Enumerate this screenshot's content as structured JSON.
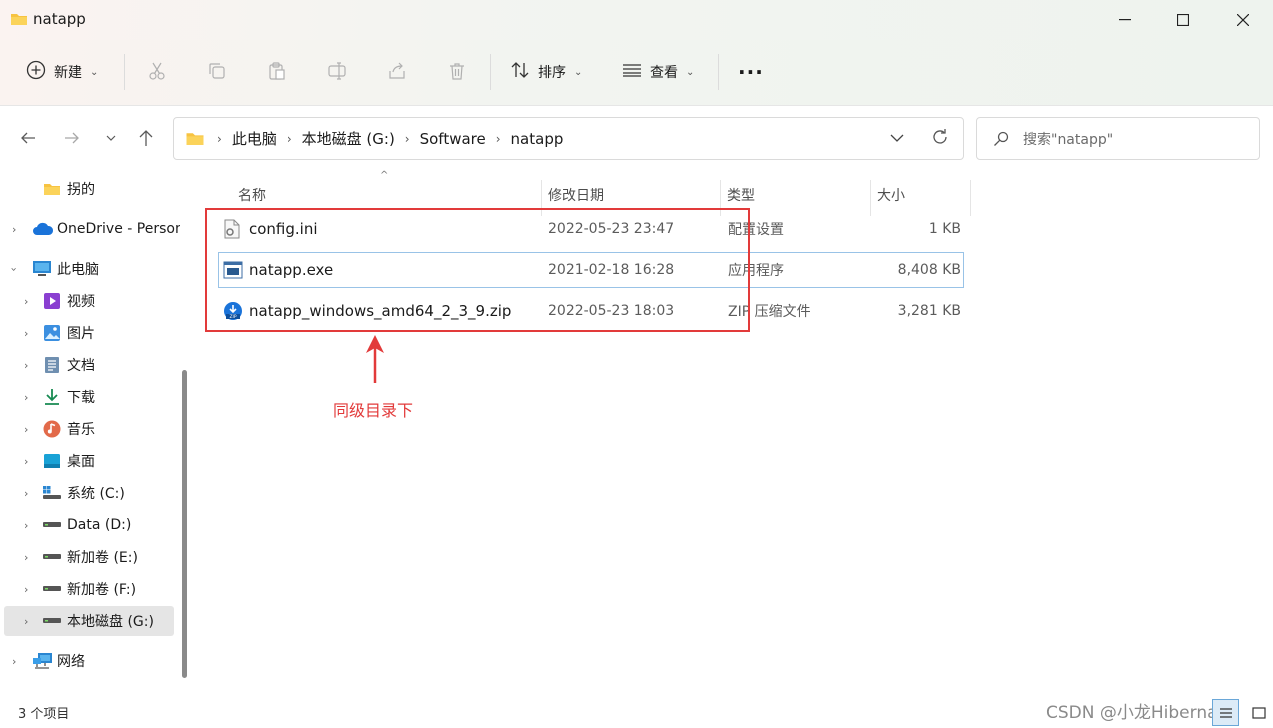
{
  "window": {
    "title": "natapp"
  },
  "toolbar": {
    "new_label": "新建",
    "sort_label": "排序",
    "view_label": "查看",
    "more_label": "···"
  },
  "address": {
    "crumbs": [
      "此电脑",
      "本地磁盘 (G:)",
      "Software",
      "natapp"
    ]
  },
  "search": {
    "placeholder": "搜索\"natapp\""
  },
  "sidebar": {
    "items": [
      {
        "label": "拐的"
      },
      {
        "label": "OneDrive - Personal"
      },
      {
        "label": "此电脑"
      },
      {
        "label": "视频"
      },
      {
        "label": "图片"
      },
      {
        "label": "文档"
      },
      {
        "label": "下载"
      },
      {
        "label": "音乐"
      },
      {
        "label": "桌面"
      },
      {
        "label": "系统 (C:)"
      },
      {
        "label": "Data (D:)"
      },
      {
        "label": "新加卷 (E:)"
      },
      {
        "label": "新加卷 (F:)"
      },
      {
        "label": "本地磁盘 (G:)"
      },
      {
        "label": "网络"
      }
    ]
  },
  "columns": {
    "name": "名称",
    "date": "修改日期",
    "type": "类型",
    "size": "大小"
  },
  "files": [
    {
      "name": "config.ini",
      "date": "2022-05-23 23:47",
      "type": "配置设置",
      "size": "1 KB"
    },
    {
      "name": "natapp.exe",
      "date": "2021-02-18 16:28",
      "type": "应用程序",
      "size": "8,408 KB"
    },
    {
      "name": "natapp_windows_amd64_2_3_9.zip",
      "date": "2022-05-23 18:03",
      "type": "ZIP 压缩文件",
      "size": "3,281 KB"
    }
  ],
  "annotation": {
    "text": "同级目录下"
  },
  "status": {
    "count": "3 个项目"
  },
  "watermark": "CSDN @小龙Hibernate",
  "colors": {
    "accent": "#0067c0",
    "annotation": "#e23a3a",
    "folder": "#f7c341"
  }
}
